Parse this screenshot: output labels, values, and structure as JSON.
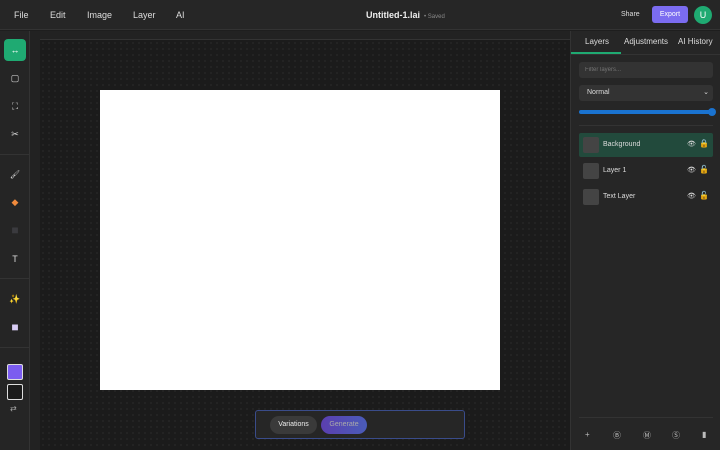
{
  "menu": [
    "File",
    "Edit",
    "Image",
    "Layer",
    "AI"
  ],
  "doc": {
    "title": "Untitled-1.lai",
    "status": "• Saved"
  },
  "header": {
    "share": "Share",
    "export": "Export",
    "avatar": "U"
  },
  "tools": [
    {
      "icon": "move-icon",
      "glyph": "↔",
      "active": true
    },
    {
      "icon": "rectangle-select-icon",
      "glyph": "▢"
    },
    {
      "icon": "crop-icon",
      "glyph": "⛶"
    },
    {
      "icon": "scissors-icon",
      "glyph": "✂"
    },
    {
      "icon": "brush-icon",
      "glyph": "🖌"
    },
    {
      "icon": "eraser-icon",
      "glyph": "◆"
    },
    {
      "icon": "fill-icon",
      "glyph": "■"
    },
    {
      "icon": "text-icon",
      "glyph": "T"
    },
    {
      "icon": "ai-magic-icon",
      "glyph": "✨"
    },
    {
      "icon": "gradient-icon",
      "glyph": "■"
    }
  ],
  "colors": {
    "primary": "#7b5cf0",
    "secondary": "#1b1b1b",
    "accent": "#1faa72",
    "export": "#7b6cf0"
  },
  "ai": {
    "variations": "Variations",
    "generate": "Generate"
  },
  "panel": {
    "tabs": [
      "Layers",
      "Adjustments",
      "AI History"
    ],
    "filter_placeholder": "Filter layers...",
    "blend_mode": "Normal",
    "opacity": 100,
    "layers": [
      {
        "name": "Background",
        "selected": true,
        "locked": true
      },
      {
        "name": "Layer 1",
        "locked": false
      },
      {
        "name": "Text Layer",
        "locked": false
      }
    ],
    "footer_icons": [
      "add-layer-icon",
      "mask-icon",
      "group-icon",
      "effects-icon",
      "trash-icon"
    ]
  }
}
